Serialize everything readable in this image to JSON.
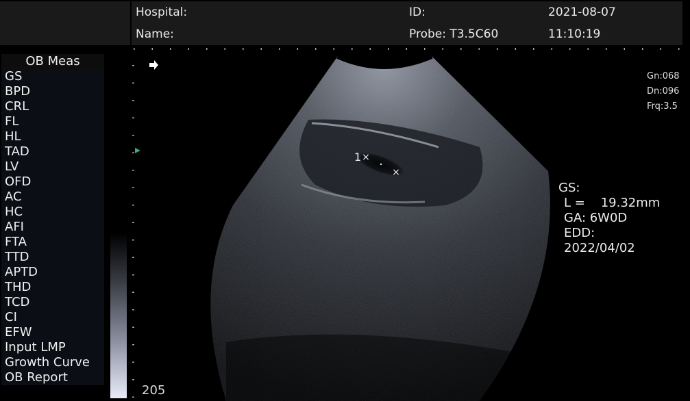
{
  "header": {
    "hospital_label": "Hospital:",
    "name_label": "Name:",
    "id_label": "ID:",
    "probe_label": "Probe: T3.5C60",
    "date": "2021-08-07",
    "time": "11:10:19"
  },
  "menu": {
    "title": "OB Meas",
    "items": [
      "GS",
      "BPD",
      "CRL",
      "FL",
      "HL",
      "TAD",
      "LV",
      "OFD",
      "AC",
      "HC",
      "AFI",
      "FTA",
      "TTD",
      "APTD",
      "THD",
      "TCD",
      "CI",
      "EFW",
      "Input LMP",
      "Growth Curve",
      "OB Report"
    ]
  },
  "params": {
    "gain": "Gn:068",
    "dynamic": "Dn:096",
    "freq": "Frq:3.5"
  },
  "measurement": {
    "title": "GS:",
    "length": "L =    19.32mm",
    "ga": "GA:  6W0D",
    "edd_label": "EDD:",
    "edd_value": "2022/04/02",
    "caliper_index": "1"
  },
  "depth_value": "205",
  "colors": {
    "header_bg": "#1a1a1a",
    "menu_bg": "#0b0e14",
    "focus_marker": "#3aa88f"
  }
}
